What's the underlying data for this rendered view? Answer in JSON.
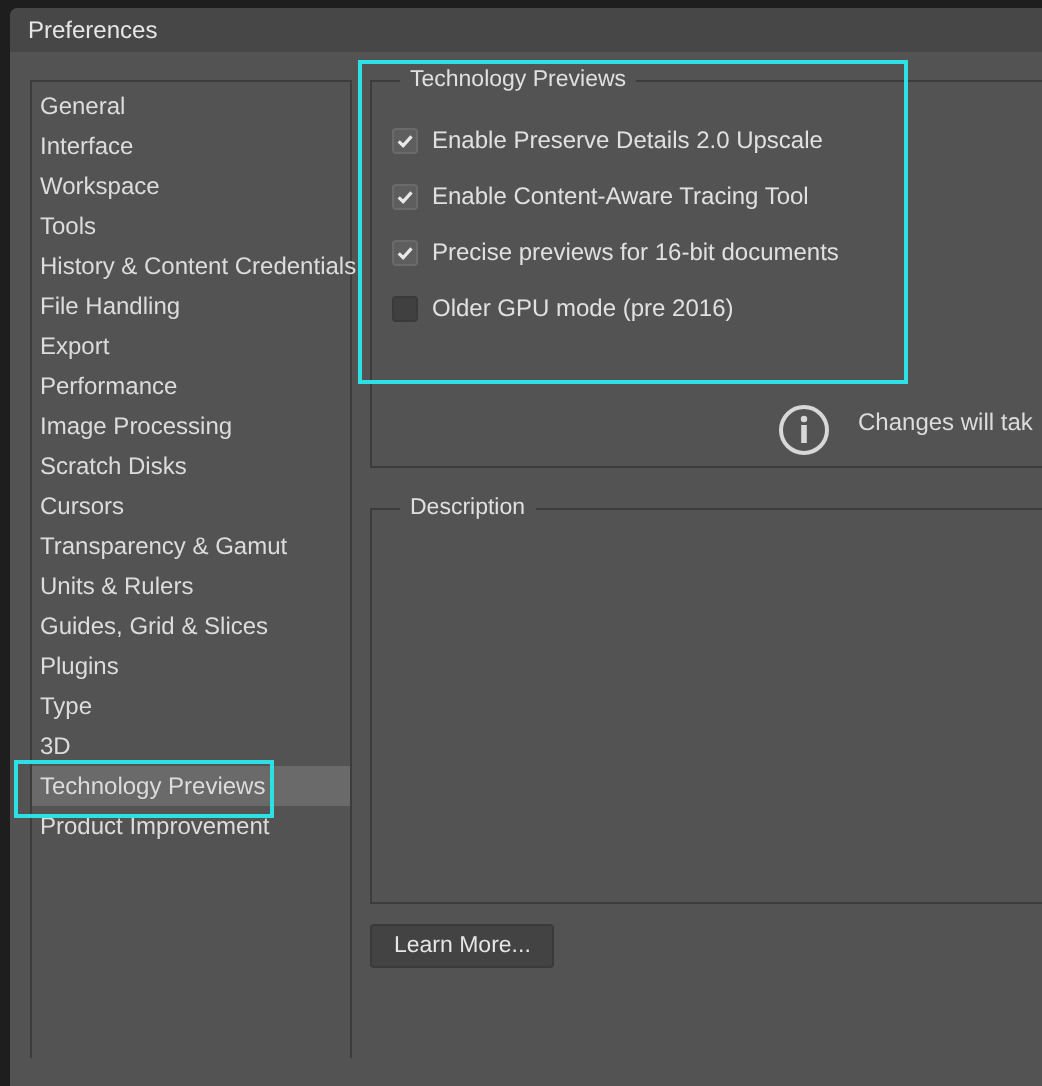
{
  "window": {
    "title": "Preferences"
  },
  "sidebar": {
    "items": [
      {
        "label": "General",
        "selected": false
      },
      {
        "label": "Interface",
        "selected": false
      },
      {
        "label": "Workspace",
        "selected": false
      },
      {
        "label": "Tools",
        "selected": false
      },
      {
        "label": "History & Content Credentials",
        "selected": false
      },
      {
        "label": "File Handling",
        "selected": false
      },
      {
        "label": "Export",
        "selected": false
      },
      {
        "label": "Performance",
        "selected": false
      },
      {
        "label": "Image Processing",
        "selected": false
      },
      {
        "label": "Scratch Disks",
        "selected": false
      },
      {
        "label": "Cursors",
        "selected": false
      },
      {
        "label": "Transparency & Gamut",
        "selected": false
      },
      {
        "label": "Units & Rulers",
        "selected": false
      },
      {
        "label": "Guides, Grid & Slices",
        "selected": false
      },
      {
        "label": "Plugins",
        "selected": false
      },
      {
        "label": "Type",
        "selected": false
      },
      {
        "label": "3D",
        "selected": false
      },
      {
        "label": "Technology Previews",
        "selected": true
      },
      {
        "label": "Product Improvement",
        "selected": false
      }
    ]
  },
  "technology_previews": {
    "title": "Technology Previews",
    "options": [
      {
        "label": "Enable Preserve Details 2.0 Upscale",
        "checked": true
      },
      {
        "label": "Enable Content-Aware Tracing Tool",
        "checked": true
      },
      {
        "label": "Precise previews for 16-bit documents",
        "checked": true
      },
      {
        "label": "Older GPU mode (pre 2016)",
        "checked": false
      }
    ],
    "notice": "Changes will tak"
  },
  "description": {
    "title": "Description"
  },
  "buttons": [
    {
      "label": "Learn More..."
    }
  ]
}
